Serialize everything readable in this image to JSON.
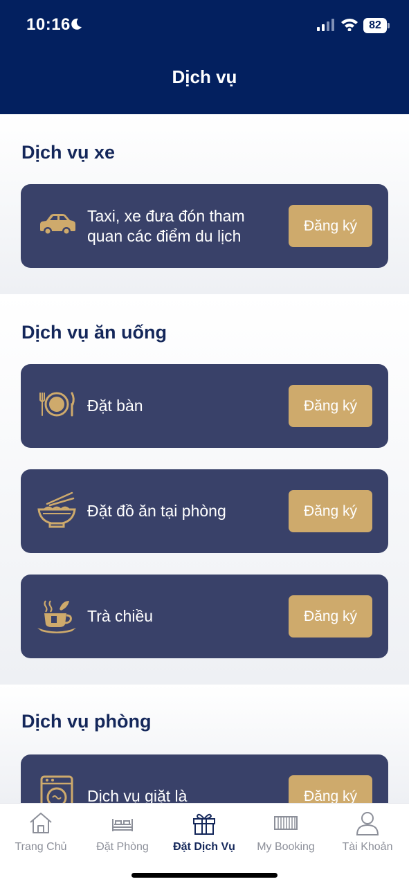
{
  "status_bar": {
    "time": "10:16",
    "battery": "82"
  },
  "header": {
    "title": "Dịch vụ"
  },
  "sections": [
    {
      "title": "Dịch vụ xe",
      "items": [
        {
          "icon": "car-icon",
          "label": "Taxi, xe đưa đón tham quan các điểm du lịch",
          "button": "Đăng ký"
        }
      ]
    },
    {
      "title": "Dịch vụ ăn uống",
      "items": [
        {
          "icon": "plate-cutlery-icon",
          "label": "Đặt bàn",
          "button": "Đăng ký"
        },
        {
          "icon": "noodle-bowl-icon",
          "label": "Đặt đồ ăn tại phòng",
          "button": "Đăng ký"
        },
        {
          "icon": "tea-cup-icon",
          "label": "Trà chiều",
          "button": "Đăng ký"
        }
      ]
    },
    {
      "title": "Dịch vụ phòng",
      "items": [
        {
          "icon": "washing-machine-icon",
          "label": "Dịch vụ giặt là",
          "button": "Đăng ký"
        }
      ]
    }
  ],
  "tabbar": {
    "active": "Đặt Dịch Vụ",
    "tabs": [
      {
        "label": "Trang Chủ",
        "icon": "home-icon"
      },
      {
        "label": "Đặt Phòng",
        "icon": "bed-icon"
      },
      {
        "label": "Đặt Dịch Vụ",
        "icon": "gift-icon"
      },
      {
        "label": "My Booking",
        "icon": "booking-icon"
      },
      {
        "label": "Tài Khoản",
        "icon": "user-icon"
      }
    ]
  },
  "colors": {
    "header": "#03205f",
    "card": "#394169",
    "accent": "#ceaa6c",
    "section_title": "#14275a"
  }
}
